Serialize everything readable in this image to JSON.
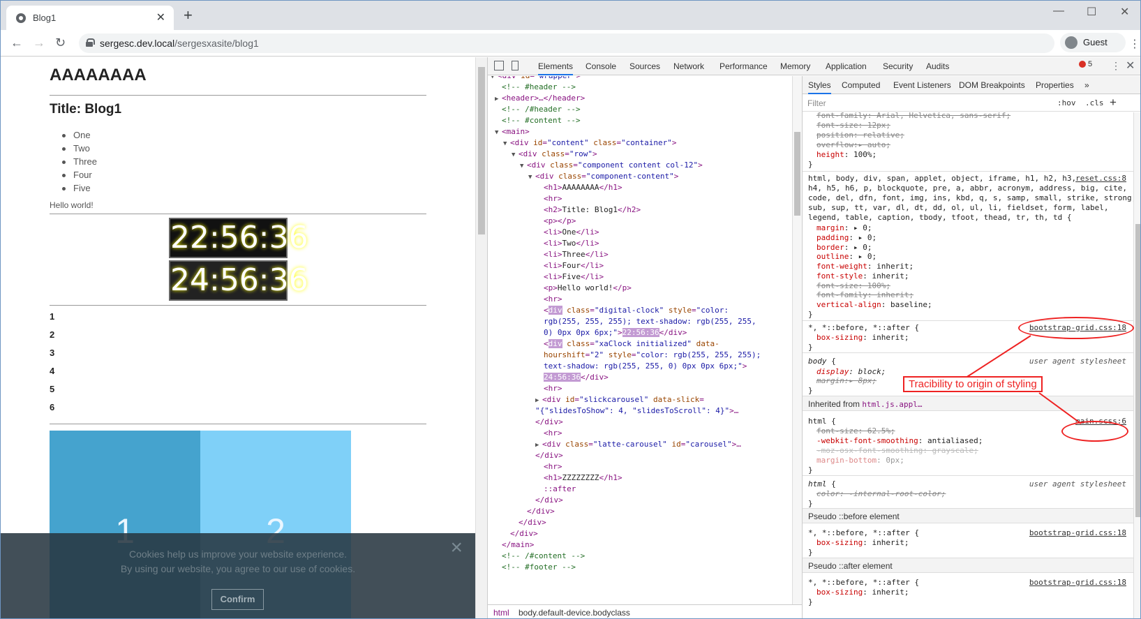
{
  "browser": {
    "tab_title": "Blog1",
    "url_host": "sergesc.dev.local",
    "url_path": "/sergesxasite/blog1",
    "profile_label": "Guest"
  },
  "page": {
    "h1": "AAAAAAAA",
    "h2": "Title: Blog1",
    "list_items": [
      "One",
      "Two",
      "Three",
      "Four",
      "Five"
    ],
    "hello": "Hello world!",
    "clock1": "22:56:36",
    "clock2": "24:56:36",
    "numbers": [
      "1",
      "2",
      "3",
      "4",
      "5",
      "6"
    ],
    "slides": [
      "1",
      "2"
    ],
    "cookie_line1": "Cookies help us improve your website experience.",
    "cookie_line2": "By using our website, you agree to our use of cookies.",
    "cookie_confirm": "Confirm",
    "cookie_close": "×"
  },
  "devtools": {
    "tabs": [
      "Elements",
      "Console",
      "Sources",
      "Network",
      "Performance",
      "Memory",
      "Application",
      "Security",
      "Audits"
    ],
    "error_count": "5",
    "styles_tabs": [
      "Styles",
      "Computed",
      "Event Listeners",
      "DOM Breakpoints",
      "Properties"
    ],
    "filter_placeholder": "Filter",
    "hov": ":hov",
    "cls": ".cls",
    "breadcrumbs": [
      "html",
      "body.default-device.bodyclass"
    ],
    "sources": {
      "reset": "reset.css:8",
      "bootstrap1": "bootstrap-grid.css:18",
      "main": "main.scss:6",
      "bootstrap2": "bootstrap-grid.css:18",
      "bootstrap3": "bootstrap-grid.css:18",
      "ua1": "user agent stylesheet",
      "ua2": "user agent stylesheet"
    },
    "sections": {
      "inherited": "Inherited from",
      "inherited_target": "html.js.appl…",
      "before": "Pseudo ::before element",
      "after": "Pseudo ::after element"
    }
  },
  "annotation": {
    "label": "Tracibility to origin of styling",
    "color": "#ee2222"
  }
}
